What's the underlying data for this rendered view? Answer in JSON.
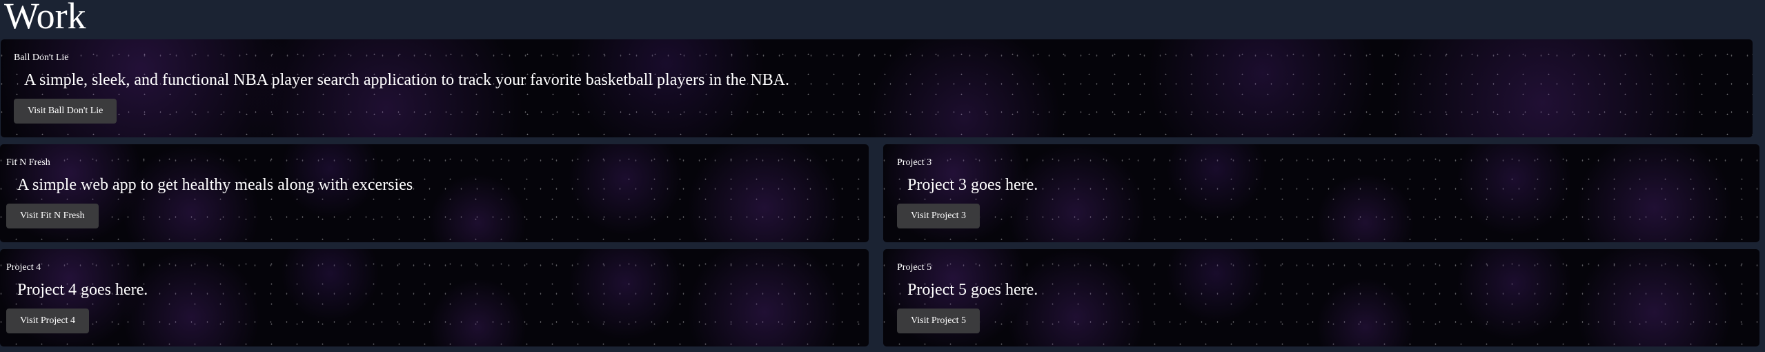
{
  "page": {
    "title": "Work"
  },
  "projects": [
    {
      "label": "Ball Don't Lie",
      "description": "A simple, sleek, and functional NBA player search application to track your favorite basketball players in the NBA.",
      "button": "Visit Ball Don't Lie"
    },
    {
      "label": "Fit N Fresh",
      "description": "A simple web app to get healthy meals along with excersies",
      "button": "Visit Fit N Fresh"
    },
    {
      "label": "Project 3",
      "description": "Project 3 goes here.",
      "button": "Visit Project 3"
    },
    {
      "label": "Project 4",
      "description": "Project 4 goes here.",
      "button": "Visit Project 4"
    },
    {
      "label": "Project 5",
      "description": "Project 5 goes here.",
      "button": "Visit Project 5"
    }
  ],
  "colors": {
    "page_background": "#1b2333",
    "card_background": "#05040a",
    "button_background": "#3b3b3d",
    "text": "#ffffff"
  }
}
